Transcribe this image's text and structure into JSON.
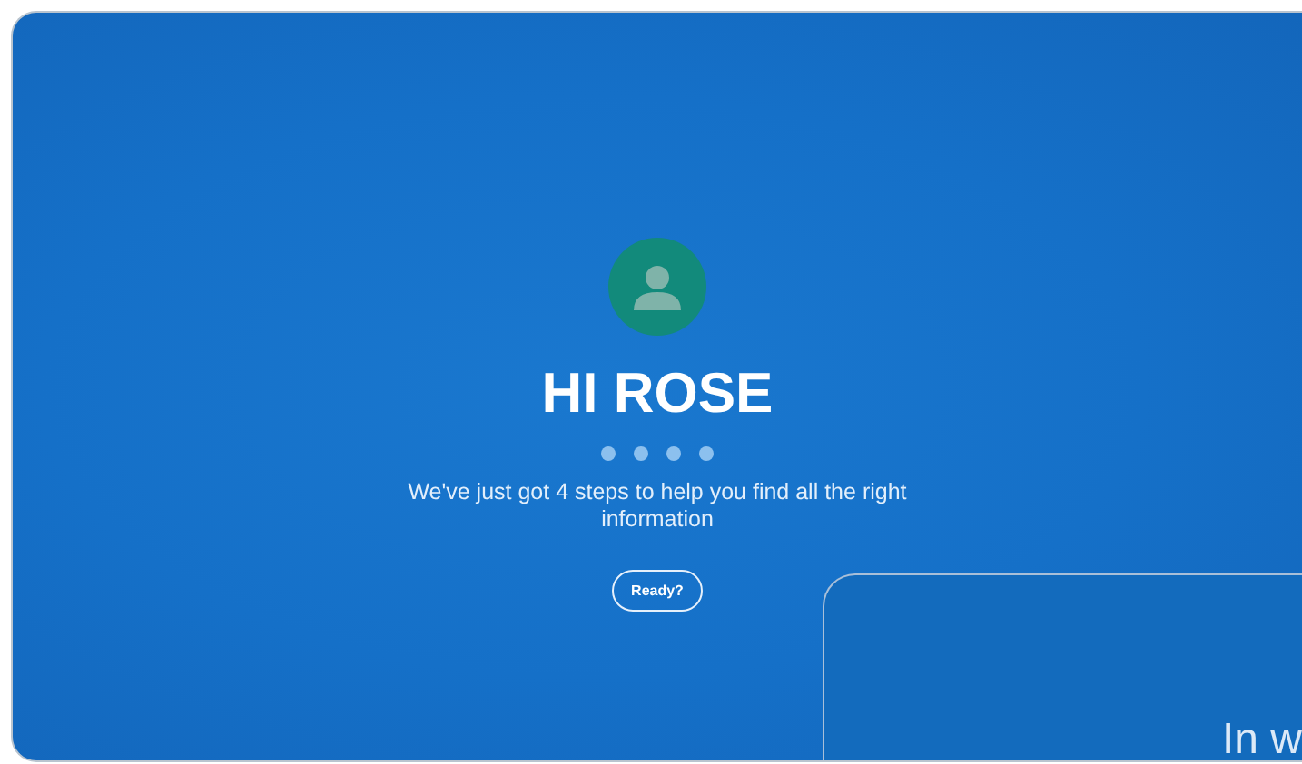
{
  "greeting": {
    "title": "HI ROSE",
    "steps": [
      {
        "selected": false
      },
      {
        "selected": false
      },
      {
        "selected": false
      },
      {
        "selected": false
      }
    ],
    "message": "We've just got 4 steps to help you find all the right",
    "message_line_2": "information",
    "button": "Ready?"
  },
  "next_card": {
    "text": "In w"
  }
}
